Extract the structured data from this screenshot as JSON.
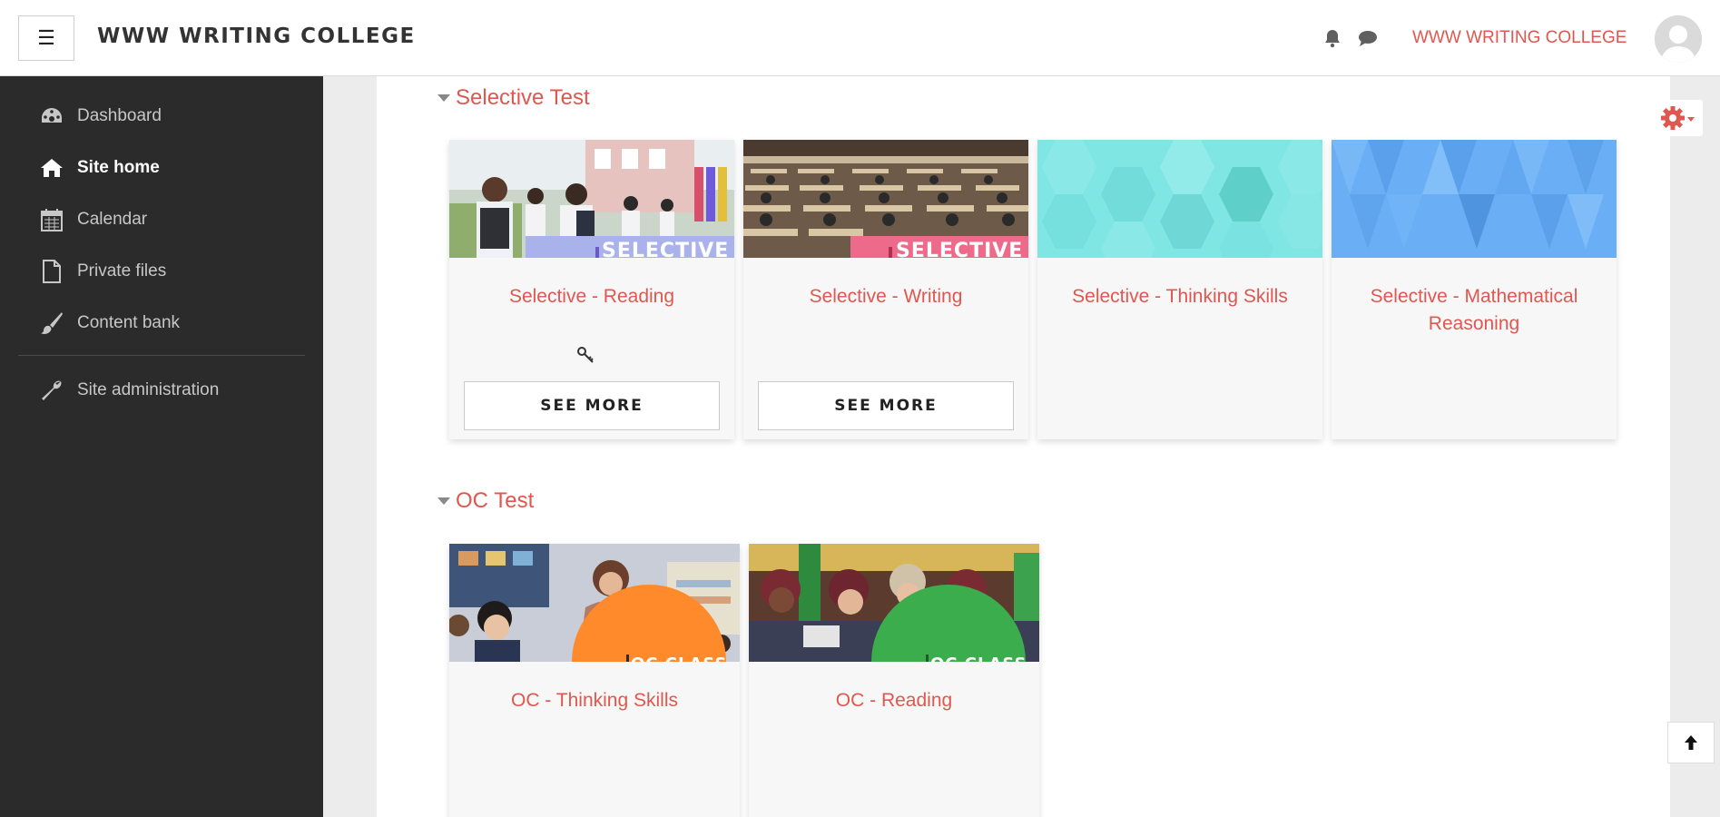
{
  "header": {
    "site_name": "WWW WRITING COLLEGE",
    "user_name": "WWW WRITING COLLEGE"
  },
  "sidebar": {
    "items": [
      {
        "label": "Dashboard",
        "icon": "dashboard-icon"
      },
      {
        "label": "Site home",
        "icon": "home-icon",
        "active": true
      },
      {
        "label": "Calendar",
        "icon": "calendar-icon"
      },
      {
        "label": "Private files",
        "icon": "file-icon"
      },
      {
        "label": "Content bank",
        "icon": "brush-icon"
      },
      {
        "label": "Site administration",
        "icon": "wrench-icon"
      }
    ]
  },
  "sections": [
    {
      "title": "Selective Test",
      "courses": [
        {
          "title": "Selective - Reading",
          "image_banner": "SELECTIVE",
          "button": "SEE MORE",
          "has_key_icon": true
        },
        {
          "title": "Selective - Writing",
          "image_banner": "SELECTIVE",
          "button": "SEE MORE"
        },
        {
          "title": "Selective - Thinking Skills"
        },
        {
          "title": "Selective - Mathematical Reasoning"
        }
      ]
    },
    {
      "title": "OC Test",
      "courses": [
        {
          "title": "OC - Thinking Skills",
          "image_banner": "OC CLASS"
        },
        {
          "title": "OC - Reading",
          "image_banner": "OC CLASS"
        }
      ]
    }
  ],
  "colors": {
    "accent": "#e0574f",
    "sidebar_bg": "#2b2b2b",
    "teal_pattern": "#7fe6e4",
    "blue_pattern": "#6aaff5",
    "orange_band": "#ff8a2b",
    "green_band": "#3cad4c",
    "purple_band": "#a9b2ea",
    "pink_band": "#ee6a8a"
  }
}
